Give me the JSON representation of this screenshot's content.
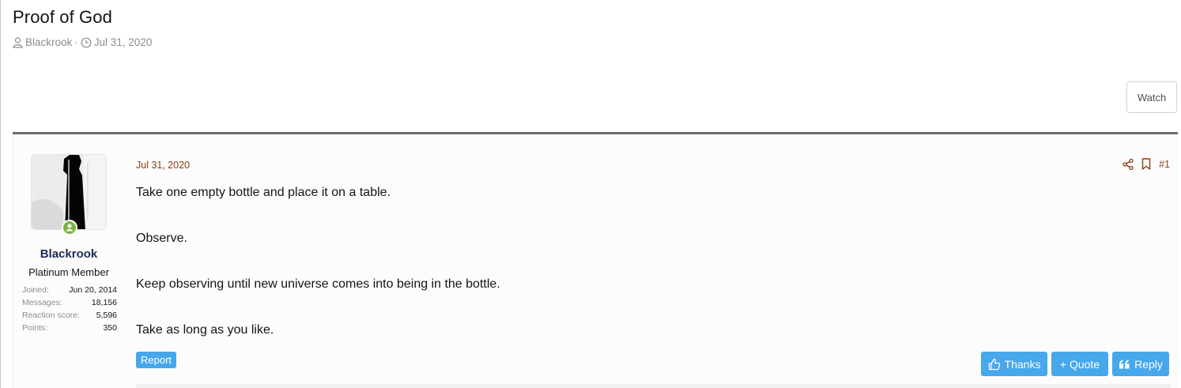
{
  "thread": {
    "title": "Proof of God",
    "author": "Blackrook",
    "separator": "·",
    "date": "Jul 31, 2020",
    "watch_label": "Watch"
  },
  "post": {
    "date": "Jul 31, 2020",
    "number": "#1",
    "body": [
      "Take one empty bottle and place it on a table.",
      "Observe.",
      "Keep observing until new universe comes into being in the bottle.",
      "Take as long as you like."
    ],
    "report_label": "Report",
    "thanks_label": "Thanks",
    "quote_label": "+ Quote",
    "reply_label": "Reply"
  },
  "user": {
    "name": "Blackrook",
    "title": "Platinum Member",
    "stats": [
      {
        "key": "Joined:",
        "value": "Jun 20, 2014"
      },
      {
        "key": "Messages:",
        "value": "18,156"
      },
      {
        "key": "Reaction score:",
        "value": "5,596"
      },
      {
        "key": "Points:",
        "value": "350"
      }
    ]
  },
  "icons": {
    "author": "user-icon",
    "date": "clock-icon",
    "share": "share-icon",
    "bookmark": "bookmark-icon",
    "online": "online-status-icon",
    "thanks": "thumbs-up-icon",
    "reply": "reply-quote-icon"
  },
  "colors": {
    "accent_button": "#47a7eb",
    "post_date": "#8a3d12",
    "username": "#1d2b55",
    "online": "#7cb342"
  }
}
